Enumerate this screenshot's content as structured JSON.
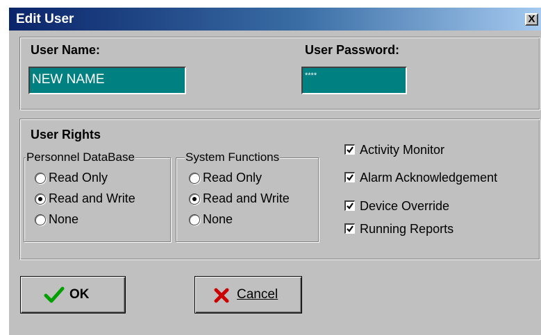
{
  "window": {
    "title": "Edit User",
    "close_label": "X"
  },
  "credentials": {
    "username_label": "User Name:",
    "username_value": "NEW NAME",
    "password_label": "User Password:",
    "password_value": "****"
  },
  "rights": {
    "heading": "User Rights",
    "personnel": {
      "legend": "Personnel DataBase",
      "options": [
        "Read Only",
        "Read and Write",
        "None"
      ],
      "selected": "Read and Write"
    },
    "system": {
      "legend": "System Functions",
      "options": [
        "Read Only",
        "Read and Write",
        "None"
      ],
      "selected": "Read and Write"
    },
    "checkboxes": [
      {
        "label": "Activity Monitor",
        "checked": true
      },
      {
        "label": "Alarm Acknowledgement",
        "checked": true
      },
      {
        "label": "Device Override",
        "checked": true
      },
      {
        "label": "Running Reports",
        "checked": true
      }
    ]
  },
  "buttons": {
    "ok_label": "OK",
    "cancel_label": "Cancel"
  },
  "colors": {
    "field_bg": "#008080",
    "dialog_bg": "#c0c0c0",
    "title_start": "#0a246a",
    "title_end": "#a6caf0",
    "ok_check": "#00a000",
    "cancel_x": "#cc0000"
  }
}
